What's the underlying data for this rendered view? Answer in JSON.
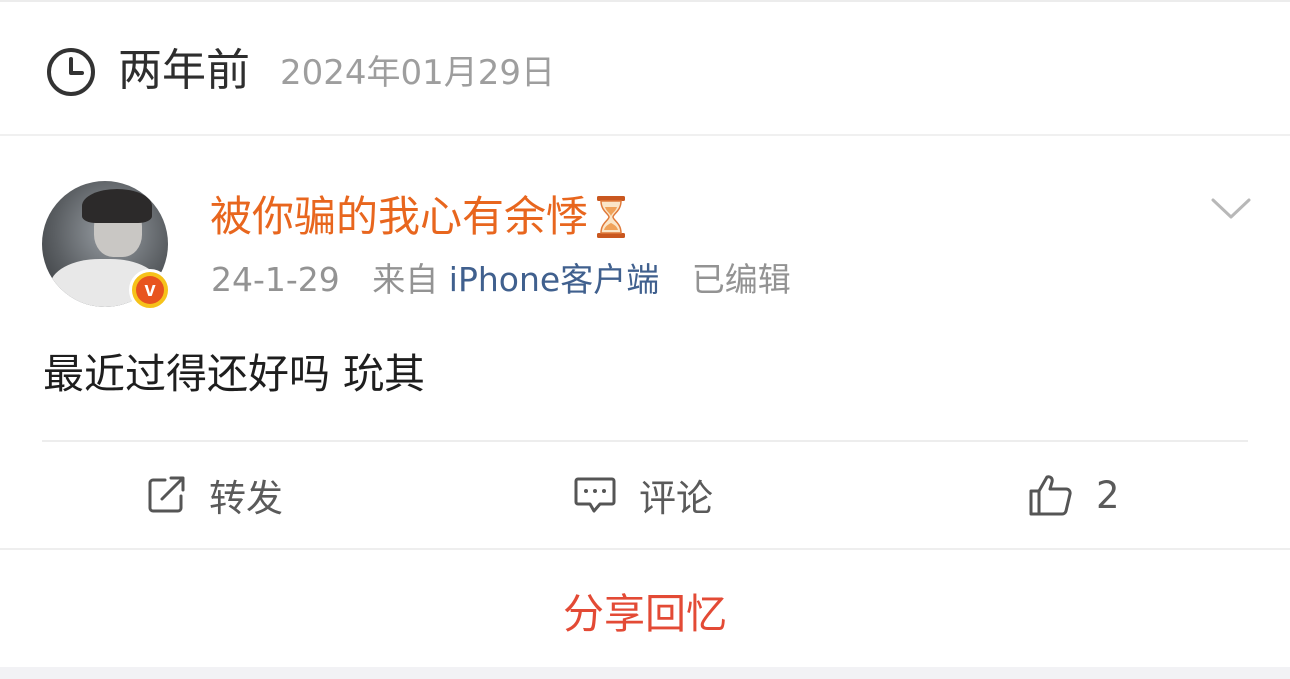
{
  "memory": {
    "relative_time": "两年前",
    "date": "2024年01月29日"
  },
  "post": {
    "username": "被你骗的我心有余悸",
    "meta": {
      "date": "24-1-29",
      "from_label": "来自",
      "source": "iPhone客户端",
      "edited": "已编辑"
    },
    "text": "最近过得还好吗 玧其",
    "badge_letter": "v"
  },
  "actions": {
    "repost_label": "转发",
    "comment_label": "评论",
    "like_count": "2"
  },
  "share": {
    "label": "分享回忆"
  },
  "colors": {
    "username": "#e8661e",
    "source_link": "#40608e",
    "share_button": "#e34a35",
    "badge_outer": "#f6c21a",
    "badge_inner": "#e8541e"
  },
  "icons": [
    "clock-icon",
    "hourglass-icon",
    "chevron-down-icon",
    "repost-icon",
    "comment-icon",
    "thumbs-up-icon"
  ]
}
